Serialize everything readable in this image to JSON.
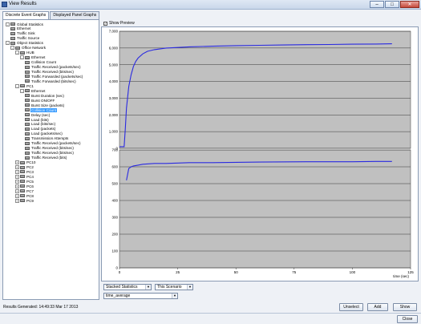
{
  "window": {
    "title": "View Results"
  },
  "tabs": [
    {
      "label": "Discrete Event Graphs"
    },
    {
      "label": "Displayed Panel Graphs"
    }
  ],
  "tree": [
    {
      "label": "Global Statistics",
      "level": 0,
      "type": "folder",
      "exp": "-"
    },
    {
      "label": "Ethernet",
      "level": 1,
      "type": "stat"
    },
    {
      "label": "Traffic Sink",
      "level": 1,
      "type": "stat"
    },
    {
      "label": "Traffic Source",
      "level": 1,
      "type": "stat"
    },
    {
      "label": "Object Statistics",
      "level": 0,
      "type": "folder",
      "exp": "-"
    },
    {
      "label": "Office Network",
      "level": 1,
      "type": "folder",
      "exp": "-"
    },
    {
      "label": "HUB",
      "level": 2,
      "type": "folder",
      "exp": "-"
    },
    {
      "label": "Ethernet",
      "level": 3,
      "type": "folder",
      "exp": "-"
    },
    {
      "label": "Collision Count",
      "level": 4,
      "type": "stat"
    },
    {
      "label": "Traffic Received (packets/sec)",
      "level": 4,
      "type": "stat"
    },
    {
      "label": "Traffic Received (bits/sec)",
      "level": 4,
      "type": "stat"
    },
    {
      "label": "Traffic Forwarded (packets/sec)",
      "level": 4,
      "type": "stat"
    },
    {
      "label": "Traffic Forwarded (bits/sec)",
      "level": 4,
      "type": "stat"
    },
    {
      "label": "PC1",
      "level": 2,
      "type": "folder",
      "exp": "-"
    },
    {
      "label": "Ethernet",
      "level": 3,
      "type": "folder",
      "exp": "-"
    },
    {
      "label": "Burst Duration (sec)",
      "level": 4,
      "type": "stat"
    },
    {
      "label": "Burst ON/OFF",
      "level": 4,
      "type": "stat"
    },
    {
      "label": "Burst Size (packets)",
      "level": 4,
      "type": "stat"
    },
    {
      "label": "Collision Count",
      "level": 4,
      "type": "stat",
      "selected": true
    },
    {
      "label": "Delay (sec)",
      "level": 4,
      "type": "stat"
    },
    {
      "label": "Load (bits)",
      "level": 4,
      "type": "stat"
    },
    {
      "label": "Load (bits/sec)",
      "level": 4,
      "type": "stat"
    },
    {
      "label": "Load (packets)",
      "level": 4,
      "type": "stat"
    },
    {
      "label": "Load (packets/sec)",
      "level": 4,
      "type": "stat"
    },
    {
      "label": "Transmission Attempts",
      "level": 4,
      "type": "stat"
    },
    {
      "label": "Traffic Received (packets/sec)",
      "level": 4,
      "type": "stat"
    },
    {
      "label": "Traffic Received (bits/sec)",
      "level": 4,
      "type": "stat"
    },
    {
      "label": "Traffic Received (bits/sec)",
      "level": 4,
      "type": "stat"
    },
    {
      "label": "Traffic Received (bits)",
      "level": 4,
      "type": "stat"
    },
    {
      "label": "PC10",
      "level": 2,
      "type": "folder",
      "exp": "+"
    },
    {
      "label": "PC2",
      "level": 2,
      "type": "folder",
      "exp": "+"
    },
    {
      "label": "PC3",
      "level": 2,
      "type": "folder",
      "exp": "+"
    },
    {
      "label": "PC4",
      "level": 2,
      "type": "folder",
      "exp": "+"
    },
    {
      "label": "PC5",
      "level": 2,
      "type": "folder",
      "exp": "+"
    },
    {
      "label": "PC6",
      "level": 2,
      "type": "folder",
      "exp": "+"
    },
    {
      "label": "PC7",
      "level": 2,
      "type": "folder",
      "exp": "+"
    },
    {
      "label": "PC8",
      "level": 2,
      "type": "folder",
      "exp": "+"
    },
    {
      "label": "PC9",
      "level": 2,
      "type": "folder",
      "exp": "+"
    }
  ],
  "preview": {
    "label": "Show Preview",
    "checked": true
  },
  "chart_data": [
    {
      "type": "line",
      "ylim": [
        0,
        7000
      ],
      "yticks": [
        "7,000",
        "6,000",
        "5,000",
        "4,000",
        "3,000",
        "2,000",
        "1,000",
        "0"
      ],
      "ytick_values": [
        7000,
        6000,
        5000,
        4000,
        3000,
        2000,
        1000,
        0
      ],
      "xlim": [
        0,
        125
      ],
      "grid": true,
      "series": [
        {
          "color": "#2a2ae0",
          "x": [
            0,
            2,
            2.5,
            3,
            4,
            5,
            6,
            7,
            8,
            10,
            12,
            15,
            20,
            30,
            40,
            50,
            60,
            70,
            80,
            90,
            100,
            110,
            117
          ],
          "y": [
            100,
            100,
            1200,
            2400,
            3700,
            4400,
            4900,
            5200,
            5400,
            5650,
            5800,
            5900,
            6000,
            6070,
            6110,
            6140,
            6160,
            6180,
            6200,
            6210,
            6230,
            6240,
            6250
          ]
        }
      ]
    },
    {
      "type": "line",
      "ylim": [
        0,
        700
      ],
      "yticks": [
        "700",
        "600",
        "500",
        "400",
        "300",
        "200",
        "100",
        "0"
      ],
      "ytick_values": [
        700,
        600,
        500,
        400,
        300,
        200,
        100,
        0
      ],
      "xlim": [
        0,
        125
      ],
      "xticks": [
        "0",
        "25",
        "50",
        "75",
        "100",
        "125"
      ],
      "xtick_values": [
        0,
        25,
        50,
        75,
        100,
        125
      ],
      "xlabel": "time (sec)",
      "grid": true,
      "series": [
        {
          "color": "#2a2ae0",
          "x": [
            3,
            4,
            5,
            6,
            8,
            10,
            15,
            20,
            30,
            40,
            60,
            80,
            100,
            110,
            117
          ],
          "y": [
            520,
            590,
            600,
            605,
            610,
            615,
            620,
            620,
            625,
            625,
            628,
            630,
            630,
            632,
            632
          ]
        }
      ]
    }
  ],
  "controls": {
    "dropdown1": "Stacked Statistics",
    "dropdown2": "This Scenario",
    "dropdown3": "time_average",
    "unselect": "Unselect",
    "add": "Add",
    "show": "Show",
    "close": "Close"
  },
  "status": "Results Generated:  14:49:33 Mar 17 2013"
}
